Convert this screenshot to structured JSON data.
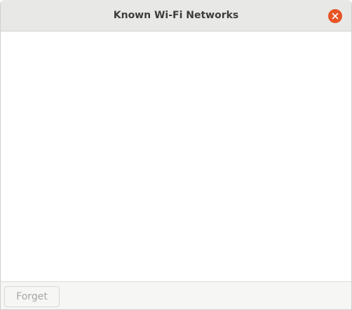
{
  "window": {
    "title": "Known Wi-Fi Networks",
    "close_icon": "close-icon",
    "accent_color": "#e75424"
  },
  "networks": [],
  "footer": {
    "forget_label": "Forget",
    "forget_enabled": false
  }
}
